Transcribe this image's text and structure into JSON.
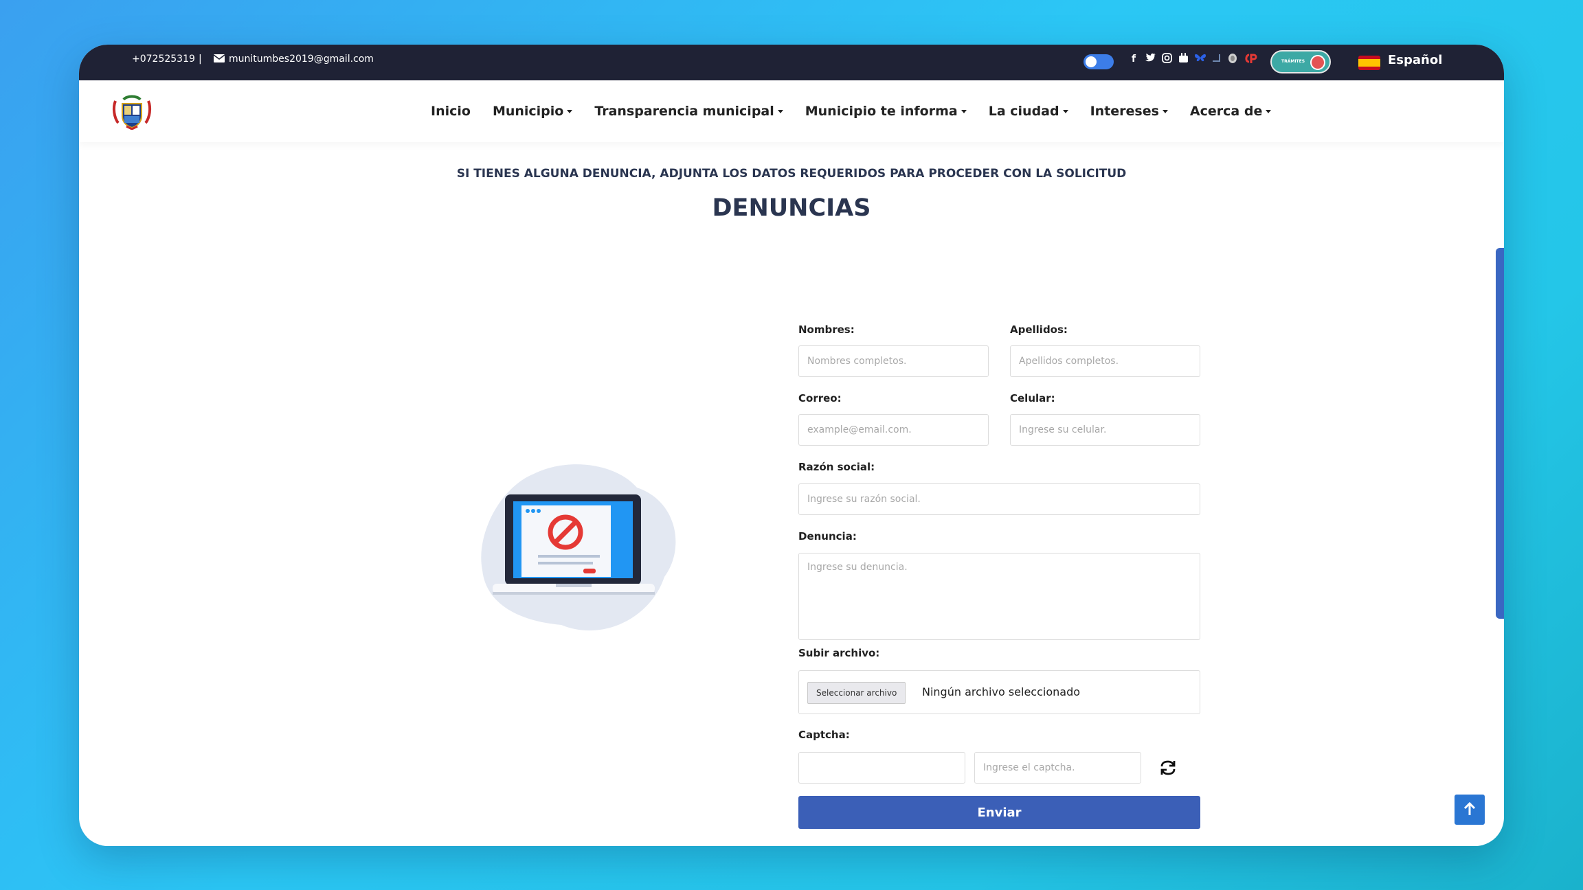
{
  "topbar": {
    "phone": "+072525319",
    "separator": "|",
    "email": "munitumbes2019@gmail.com",
    "social_icons": [
      "facebook-icon",
      "twitter-icon",
      "instagram-icon",
      "youtube-icon",
      "bluesky-icon",
      "link-icon",
      "seal-icon",
      "cp-icon"
    ],
    "tramites_label": "TRÁMITES",
    "language": "Español"
  },
  "nav": {
    "items": [
      {
        "label": "Inicio",
        "dropdown": false
      },
      {
        "label": "Municipio",
        "dropdown": true
      },
      {
        "label": "Transparencia municipal",
        "dropdown": true
      },
      {
        "label": "Municipio te informa",
        "dropdown": true
      },
      {
        "label": "La ciudad",
        "dropdown": true
      },
      {
        "label": "Intereses",
        "dropdown": true
      },
      {
        "label": "Acerca de",
        "dropdown": true
      }
    ]
  },
  "page": {
    "subtitle": "SI TIENES ALGUNA DENUNCIA, ADJUNTA LOS DATOS REQUERIDOS PARA PROCEDER CON LA SOLICITUD",
    "title": "DENUNCIAS"
  },
  "form": {
    "nombres": {
      "label": "Nombres:",
      "placeholder": "Nombres completos.",
      "value": ""
    },
    "apellidos": {
      "label": "Apellidos:",
      "placeholder": "Apellidos completos.",
      "value": ""
    },
    "correo": {
      "label": "Correo:",
      "placeholder": "example@email.com.",
      "value": ""
    },
    "celular": {
      "label": "Celular:",
      "placeholder": "Ingrese su celular.",
      "value": ""
    },
    "razon": {
      "label": "Razón social:",
      "placeholder": "Ingrese su razón social.",
      "value": ""
    },
    "denuncia": {
      "label": "Denuncia:",
      "placeholder": "Ingrese su denuncia.",
      "value": ""
    },
    "archivo": {
      "label": "Subir archivo:",
      "button": "Seleccionar archivo",
      "status": "Ningún archivo seleccionado"
    },
    "captcha": {
      "label": "Captcha:",
      "code": "",
      "placeholder": "Ingrese el captcha."
    },
    "submit": "Enviar"
  },
  "colors": {
    "topbar": "#1f2235",
    "primary": "#3b5fb7",
    "heading": "#2a3550",
    "accent_red": "#e53935"
  }
}
